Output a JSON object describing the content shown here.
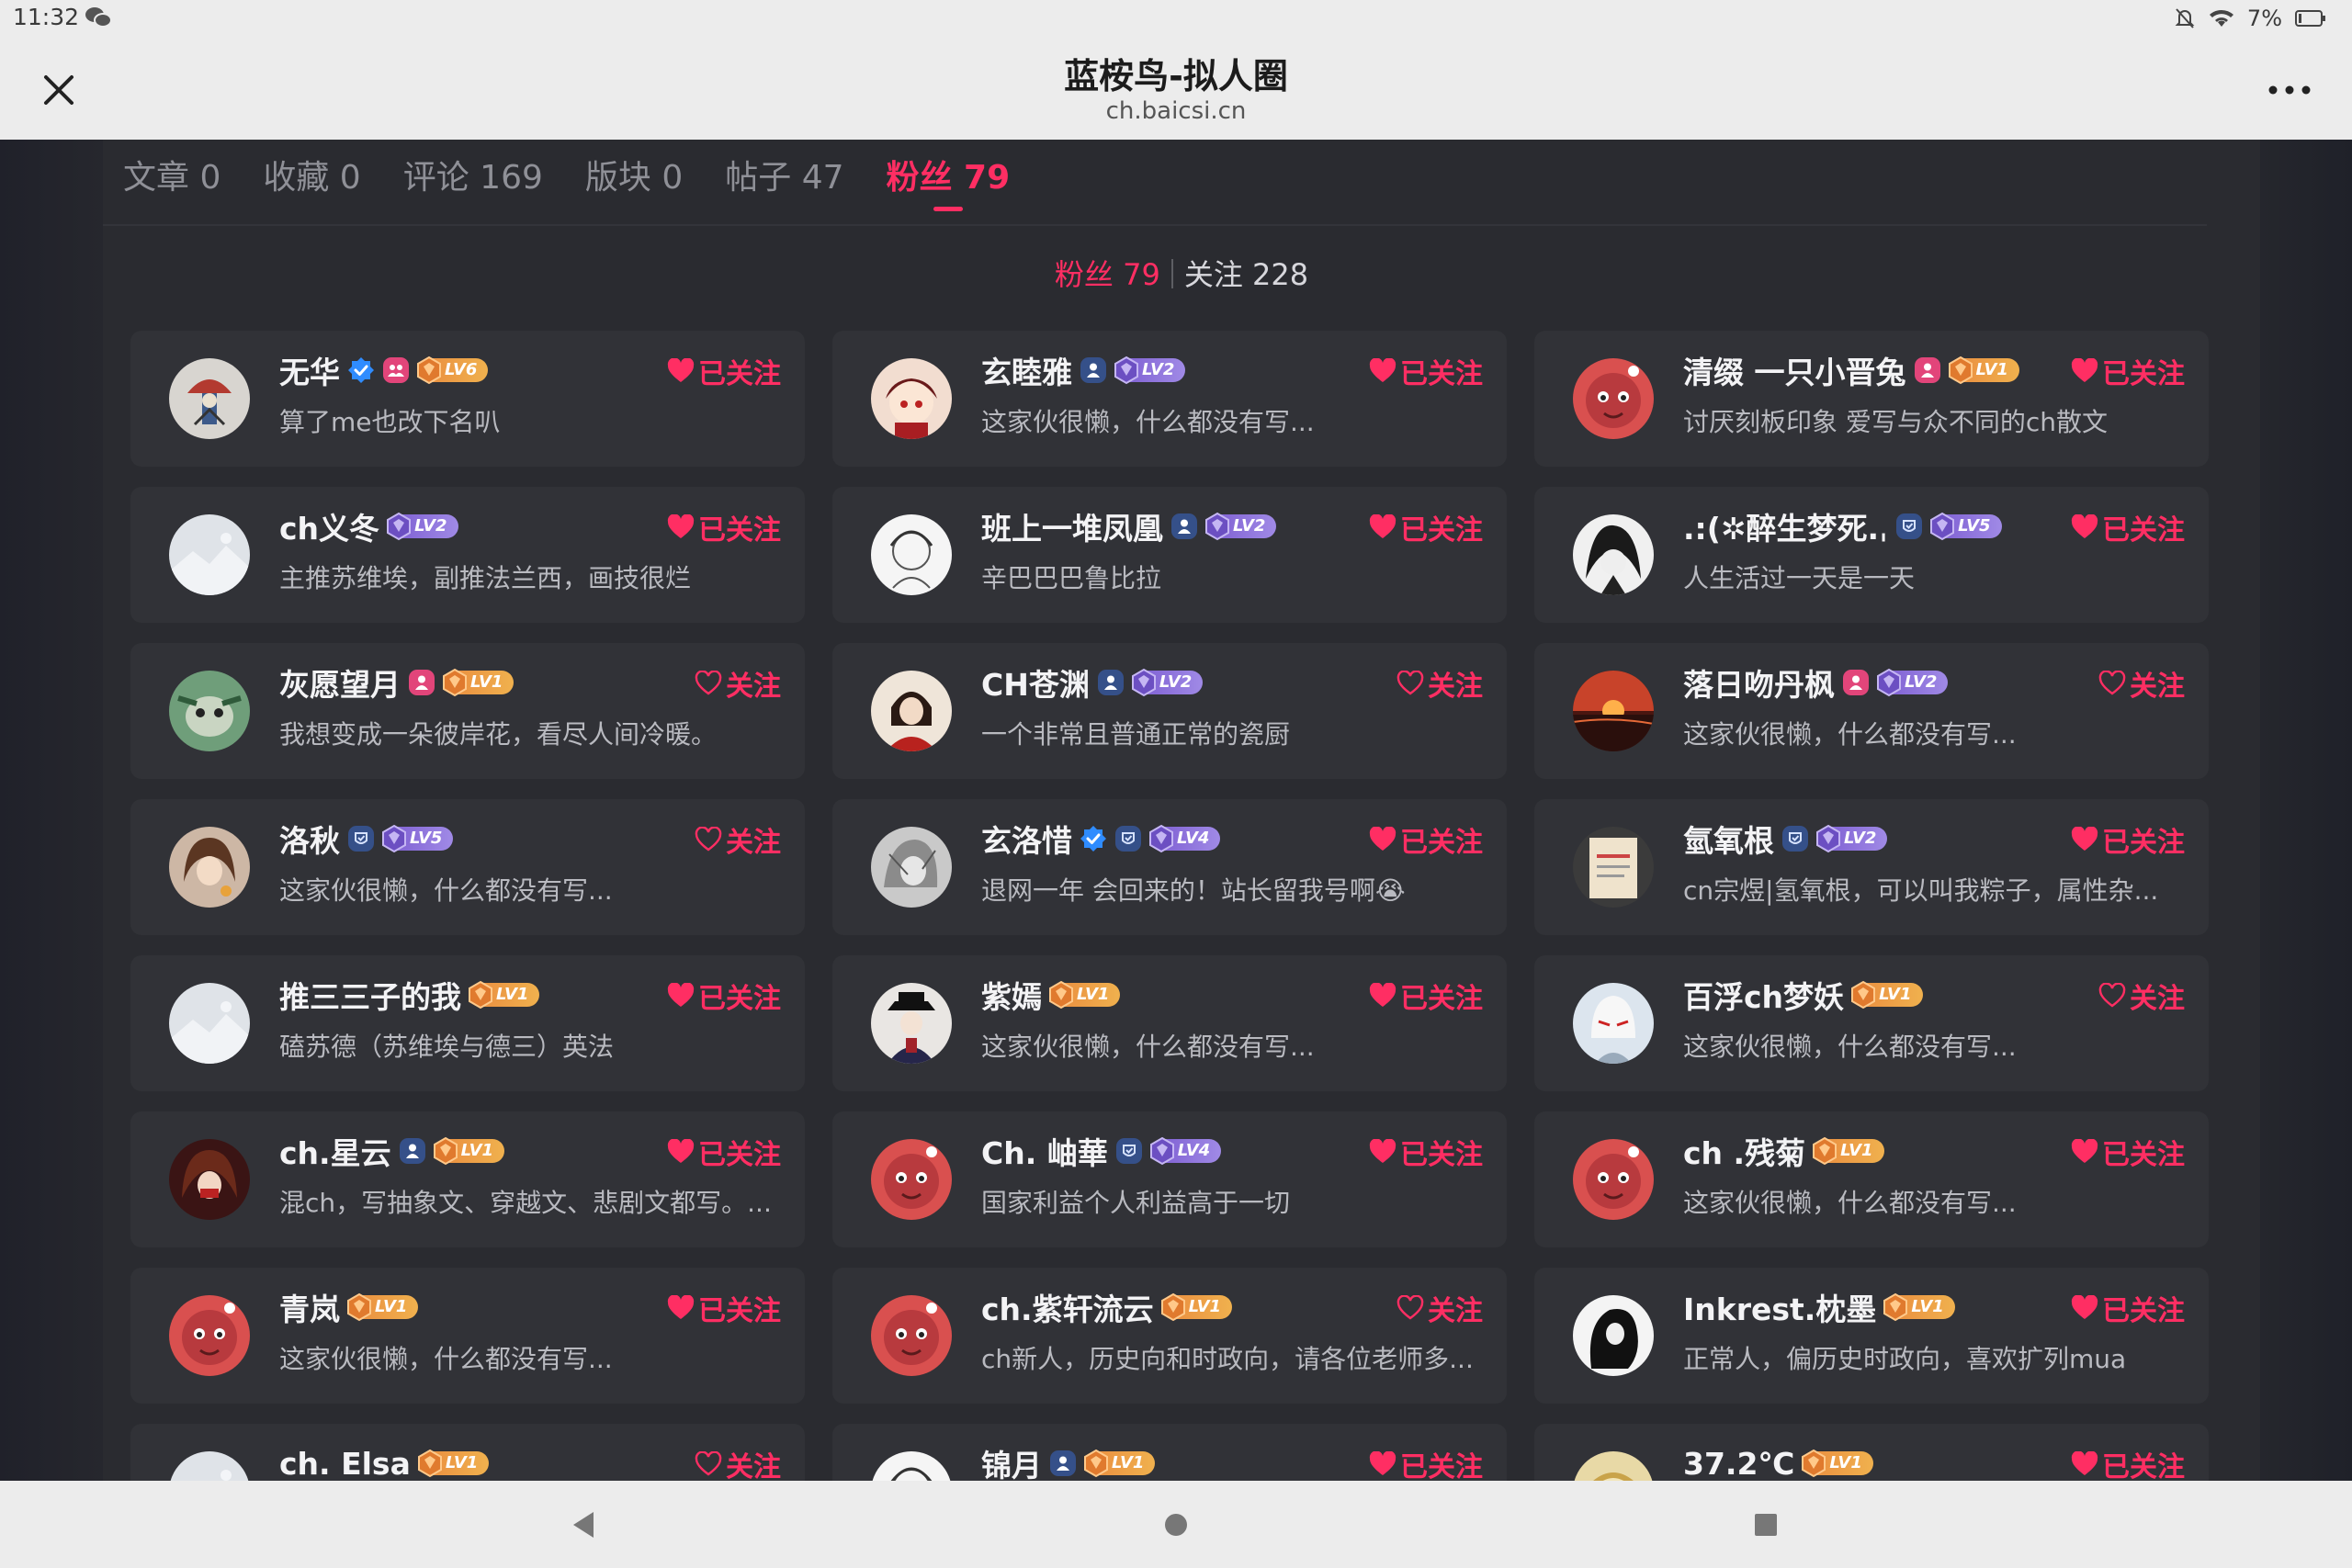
{
  "status": {
    "time": "11:32",
    "battery": "7%"
  },
  "header": {
    "title": "蓝桉鸟-拟人圈",
    "url": "ch.baicsi.cn"
  },
  "tabs": [
    {
      "label": "文章 0",
      "active": false
    },
    {
      "label": "收藏 0",
      "active": false
    },
    {
      "label": "评论 169",
      "active": false
    },
    {
      "label": "版块 0",
      "active": false
    },
    {
      "label": "帖子 47",
      "active": false
    },
    {
      "label": "粉丝 79",
      "active": true
    }
  ],
  "subtabs": {
    "fans": "粉丝 79",
    "following": "关注 228"
  },
  "labels": {
    "followed": "已关注",
    "follow": "关注"
  },
  "colors": {
    "accent": "#ff2e63",
    "lv_orange": "#e98a3e",
    "lv_purple": "#8b6bd8",
    "verified": "#2f8cff"
  },
  "users": [
    {
      "name": "无华",
      "badges": [
        "verified-icon",
        "pink-group-icon"
      ],
      "level": "LV6",
      "level_color": "orange",
      "bio": "算了me也改下名叭",
      "followed": true,
      "avatar": "totem"
    },
    {
      "name": "玄睦雅",
      "badges": [
        "blue-person-icon"
      ],
      "level": "LV2",
      "level_color": "purple",
      "bio": "这家伙很懒，什么都没有写...",
      "followed": true,
      "avatar": "chibi-red"
    },
    {
      "name": "清缀 一只小晋兔",
      "badges": [
        "pink-person-icon"
      ],
      "level": "LV1",
      "level_color": "orange",
      "bio": "讨厌刻板印象 爱写与众不同的ch散文",
      "followed": true,
      "avatar": "red-blob"
    },
    {
      "name": "ch义冬",
      "badges": [],
      "level": "LV2",
      "level_color": "purple",
      "bio": "主推苏维埃，副推法兰西，画技很烂",
      "followed": true,
      "avatar": "placeholder"
    },
    {
      "name": "班上一堆凤凰",
      "badges": [
        "blue-person-icon"
      ],
      "level": "LV2",
      "level_color": "purple",
      "bio": "辛巴巴巴鲁比拉",
      "followed": true,
      "avatar": "sketch"
    },
    {
      "name": ".:(✲醉生梦死.ˌ ",
      "badges": [
        "blue-shield-icon"
      ],
      "level": "LV5",
      "level_color": "purple",
      "bio": "人生活过一天是一天",
      "followed": true,
      "avatar": "dark-hair"
    },
    {
      "name": "灰愿望月",
      "badges": [
        "pink-person-icon"
      ],
      "level": "LV1",
      "level_color": "orange",
      "bio": "我想变成一朵彼岸花，看尽人间冷暖。",
      "followed": false,
      "avatar": "green-creature"
    },
    {
      "name": "CH苍渊",
      "badges": [
        "blue-person-icon"
      ],
      "level": "LV2",
      "level_color": "purple",
      "bio": "一个非常且普通正常的瓷厨",
      "followed": false,
      "avatar": "red-robe"
    },
    {
      "name": "落日吻丹枫",
      "badges": [
        "pink-person-icon"
      ],
      "level": "LV2",
      "level_color": "purple",
      "bio": "这家伙很懒，什么都没有写...",
      "followed": false,
      "avatar": "sunset"
    },
    {
      "name": "洛秋",
      "badges": [
        "blue-shield-icon"
      ],
      "level": "LV5",
      "level_color": "purple",
      "bio": "这家伙很懒，什么都没有写...",
      "followed": false,
      "avatar": "brown-hair"
    },
    {
      "name": "玄洛惜",
      "badges": [
        "verified-icon",
        "blue-shield-icon"
      ],
      "level": "LV4",
      "level_color": "purple",
      "bio": "退网一年 会回来的！站长留我号啊😭",
      "followed": true,
      "avatar": "grey-sketch"
    },
    {
      "name": "氫氧根",
      "badges": [
        "blue-shield-icon"
      ],
      "level": "LV2",
      "level_color": "purple",
      "bio": "cn宗煜|氢氧根，可以叫我粽子，属性杂...",
      "followed": true,
      "avatar": "document"
    },
    {
      "name": "推三三子的我",
      "badges": [],
      "level": "LV1",
      "level_color": "orange",
      "bio": "磕苏德（苏维埃与德三）英法",
      "followed": true,
      "avatar": "placeholder"
    },
    {
      "name": "紫嫣",
      "badges": [],
      "level": "LV1",
      "level_color": "orange",
      "bio": "这家伙很懒，什么都没有写...",
      "followed": true,
      "avatar": "hat-figure"
    },
    {
      "name": "百浮ch梦妖",
      "badges": [],
      "level": "LV1",
      "level_color": "orange",
      "bio": "这家伙很懒，什么都没有写...",
      "followed": false,
      "avatar": "white-mask"
    },
    {
      "name": "ch.星云",
      "badges": [
        "blue-person-icon"
      ],
      "level": "LV1",
      "level_color": "orange",
      "bio": "混ch，写抽象文、穿越文、悲剧文都写。...",
      "followed": true,
      "avatar": "red-dark"
    },
    {
      "name": "Ch. 岫華",
      "badges": [
        "blue-shield-icon"
      ],
      "level": "LV4",
      "level_color": "purple",
      "bio": "国家利益个人利益高于一切",
      "followed": true,
      "avatar": "red-blob"
    },
    {
      "name": "ch .残菊",
      "badges": [],
      "level": "LV1",
      "level_color": "orange",
      "bio": "这家伙很懒，什么都没有写...",
      "followed": true,
      "avatar": "red-blob"
    },
    {
      "name": "青岚",
      "badges": [],
      "level": "LV1",
      "level_color": "orange",
      "bio": "这家伙很懒，什么都没有写...",
      "followed": true,
      "avatar": "red-blob"
    },
    {
      "name": "ch.紫轩流云",
      "badges": [],
      "level": "LV1",
      "level_color": "orange",
      "bio": "ch新人，历史向和时政向，请各位老师多...",
      "followed": false,
      "avatar": "red-blob"
    },
    {
      "name": "Inkrest.枕墨",
      "badges": [],
      "level": "LV1",
      "level_color": "orange",
      "bio": "正常人，偏历史时政向，喜欢扩列mua",
      "followed": true,
      "avatar": "ink"
    },
    {
      "name": "ch. Elsa",
      "badges": [],
      "level": "LV1",
      "level_color": "orange",
      "bio": "",
      "followed": false,
      "avatar": "placeholder"
    },
    {
      "name": "锦月",
      "badges": [
        "blue-person-icon"
      ],
      "level": "LV1",
      "level_color": "orange",
      "bio": "",
      "followed": true,
      "avatar": "sketch"
    },
    {
      "name": "37.2℃",
      "badges": [],
      "level": "LV1",
      "level_color": "orange",
      "bio": "",
      "followed": true,
      "avatar": "yellow"
    }
  ]
}
